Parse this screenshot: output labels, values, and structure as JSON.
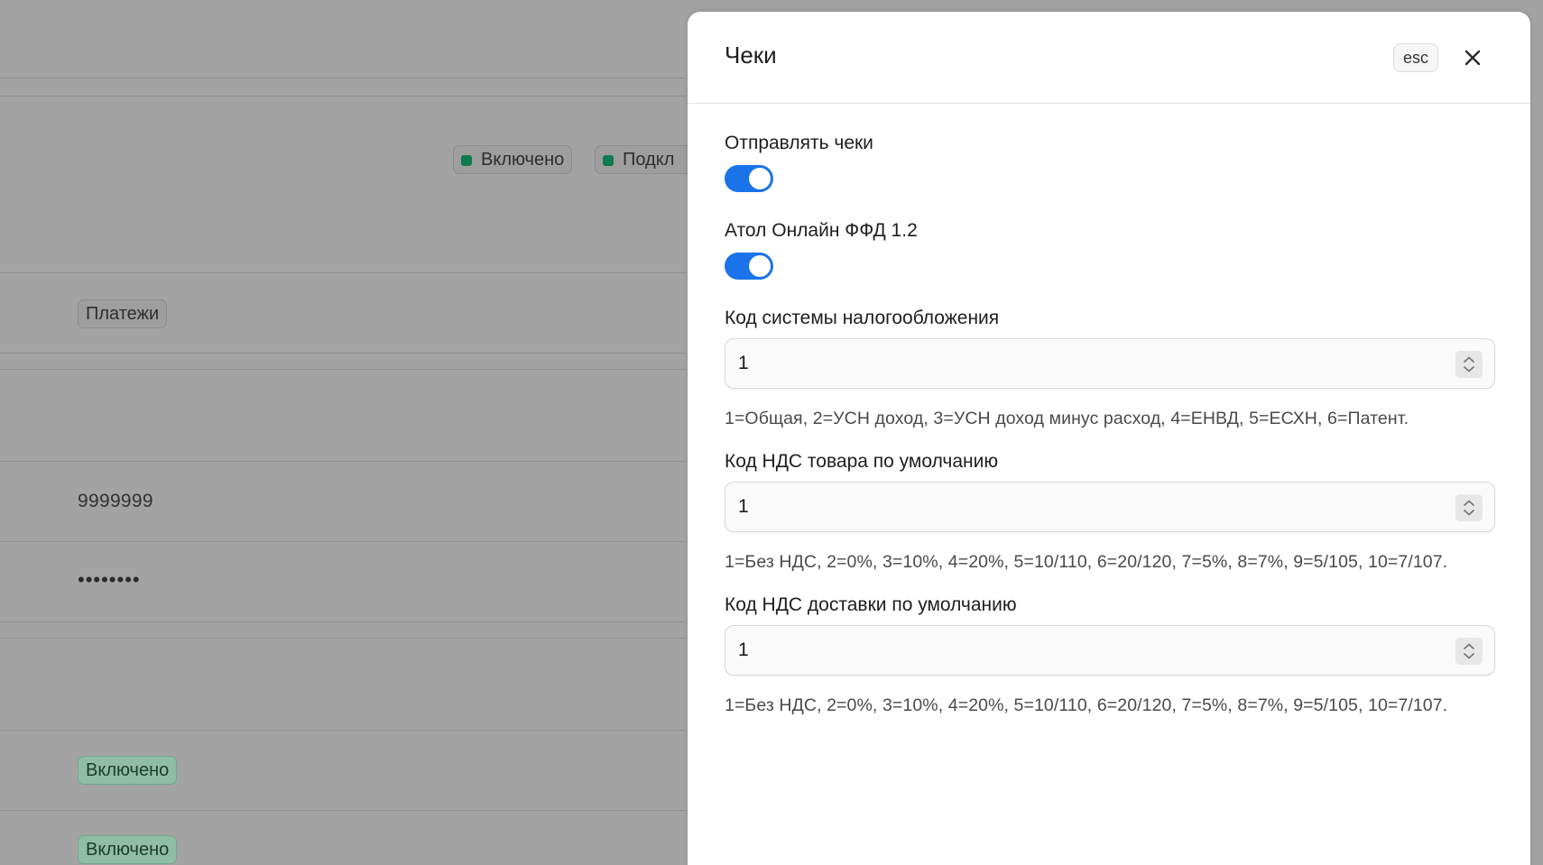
{
  "background": {
    "badges": {
      "enabled": "Включено",
      "connected": "Подкл",
      "payments": "Платежи"
    },
    "login_value": "9999999",
    "password_mask": "••••••••",
    "status_badges": [
      "Включено",
      "Включено"
    ]
  },
  "panel": {
    "title": "Чеки",
    "esc_label": "esc",
    "send_receipts": {
      "label": "Отправлять чеки",
      "enabled": true
    },
    "atol_ffd": {
      "label": "Атол Онлайн ФФД 1.2",
      "enabled": true
    },
    "tax_system": {
      "label": "Код системы налогообложения",
      "value": "1",
      "hint": "1=Общая, 2=УСН доход, 3=УСН доход минус расход, 4=ЕНВД, 5=ЕСХН, 6=Патент."
    },
    "vat_goods": {
      "label": "Код НДС товара по умолчанию",
      "value": "1",
      "hint": "1=Без НДС, 2=0%, 3=10%, 4=20%, 5=10/110, 6=20/120, 7=5%, 8=7%, 9=5/105, 10=7/107."
    },
    "vat_delivery": {
      "label": "Код НДС доставки по умолчанию",
      "value": "1",
      "hint": "1=Без НДС, 2=0%, 3=10%, 4=20%, 5=10/110, 6=20/120, 7=5%, 8=7%, 9=5/105, 10=7/107."
    }
  },
  "colors": {
    "overlay_bg": "#a3a3a3",
    "toggle_on": "#1a73e8",
    "status_green": "#0e7a4f"
  },
  "icons": {
    "close": "close-icon",
    "stepper": "stepper-icon"
  }
}
